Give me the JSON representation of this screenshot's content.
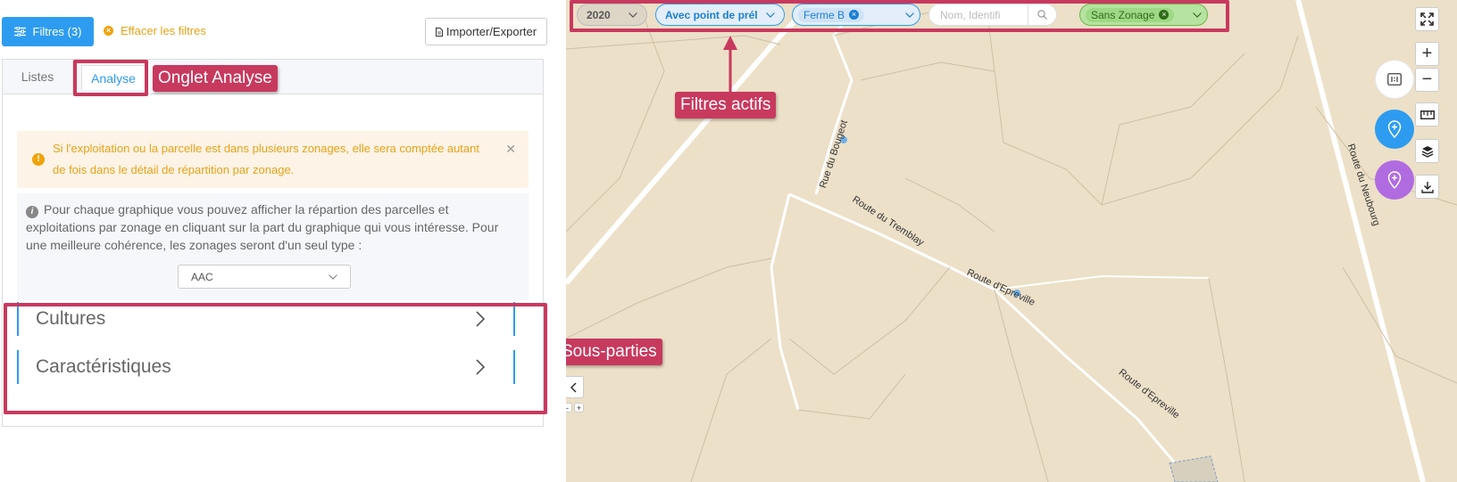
{
  "toolbar": {
    "filters_label": "Filtres (3)",
    "clear_label": "Effacer les filtres",
    "import_label": "Importer/Exporter"
  },
  "tabs": [
    {
      "label": "Listes"
    },
    {
      "label": "Analyse"
    }
  ],
  "alert": {
    "text": "Si l'exploitation ou la parcelle est dans plusieurs zonages, elle sera comptée autant de fois dans le détail de répartition par zonage."
  },
  "info": {
    "text": "Pour chaque graphique vous pouvez afficher la répartion des parcelles et exploitations par zonage en cliquant sur la part du graphique qui vous intéresse. Pour une meilleure cohérence, les zonages seront d'un seul type :",
    "select_value": "AAC"
  },
  "sections": [
    {
      "label": "Cultures"
    },
    {
      "label": "Caractéristiques"
    }
  ],
  "annotations": {
    "tab": "Onglet Analyse",
    "filters": "Filtres actifs",
    "sections": "Sous-parties"
  },
  "map_filters": {
    "year": "2020",
    "point": "Avec point de prél",
    "farm_tag": "Ferme B",
    "search_placeholder": "Nom, Identifi",
    "zoning_tag": "Sans Zonage"
  },
  "map_labels": {
    "road1": "Rue du Bougeot",
    "road2": "Route du Tremblay",
    "road3": "Route d'Epreville",
    "road4": "Route d'Epreville",
    "road5": "Route du Neubourg"
  },
  "map_controls": {
    "zoom_in": "+",
    "zoom_out": "−",
    "small_minus": "-",
    "small_plus": "+"
  },
  "colors": {
    "primary": "#2d9cf0",
    "warning": "#e8a317",
    "annotation": "#c8395e",
    "map_bg": "#ece0c8",
    "purple": "#b06be0"
  }
}
